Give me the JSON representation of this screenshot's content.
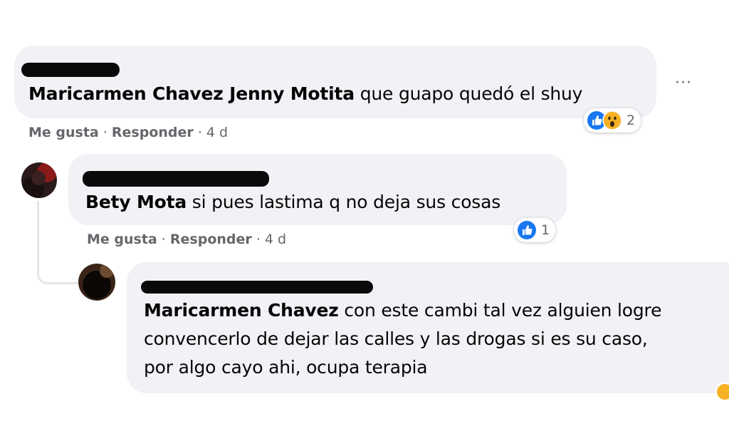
{
  "comments": [
    {
      "author": "Maricarmen Chavez Jenny Motita",
      "text": "que guapo quedó el shuy",
      "like_label": "Me gusta",
      "reply_label": "Responder",
      "time": "4 d",
      "reaction_count": "2",
      "reactions": [
        "like-icon",
        "wow-icon"
      ],
      "more_label": "···"
    },
    {
      "author": "Bety Mota",
      "text": "si pues lastima q no deja sus cosas",
      "like_label": "Me gusta",
      "reply_label": "Responder",
      "time": "4 d",
      "reaction_count": "1",
      "reactions": [
        "like-icon"
      ]
    },
    {
      "author": "Maricarmen Chavez",
      "text_line1": "con este cambi tal vez alguien logre",
      "text_line2": "convencerlo de dejar las calles y las drogas si es su caso,",
      "text_line3": "por algo cayo ahi, ocupa terapia"
    }
  ],
  "separator": "·",
  "colors": {
    "bubble": "#f0f2f5",
    "secondary_text": "#65676b",
    "like_blue": "#1877f2",
    "wow_yellow": "#f7b125"
  }
}
